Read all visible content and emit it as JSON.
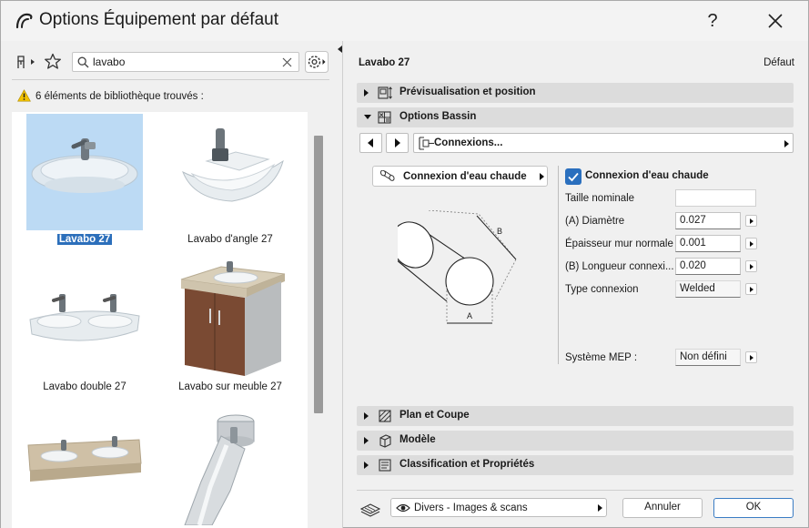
{
  "window": {
    "title": "Options Équipement par défaut",
    "help_label": "?"
  },
  "library": {
    "search": {
      "value": "lavabo",
      "placeholder": ""
    },
    "results_text": "6 éléments de bibliothèque trouvés :",
    "items": [
      {
        "label": "Lavabo 27",
        "selected": true
      },
      {
        "label": "Lavabo d'angle 27",
        "selected": false
      },
      {
        "label": "Lavabo double 27",
        "selected": false
      },
      {
        "label": "Lavabo sur meuble 27",
        "selected": false
      },
      {
        "label": "",
        "selected": false
      },
      {
        "label": "",
        "selected": false
      }
    ]
  },
  "settings": {
    "object_name": "Lavabo 27",
    "default_label": "Défaut",
    "sections": {
      "preview": "Prévisualisation et position",
      "basin_options": "Options Bassin",
      "plan": "Plan et Coupe",
      "model": "Modèle",
      "classification": "Classification et Propriétés"
    },
    "page_select": "Connexions...",
    "connection_button": "Connexion d'eau chaude",
    "diagram_labels": {
      "a": "A",
      "b": "B"
    },
    "params": {
      "enabled_label": "Connexion d'eau chaude",
      "enabled": true,
      "nominal_size": {
        "label": "Taille nominale",
        "value": ""
      },
      "diameter": {
        "label": "(A) Diamètre",
        "value": "0.027"
      },
      "wall_thickness": {
        "label": "Épaisseur mur normale",
        "value": "0.001"
      },
      "length": {
        "label": "(B) Longueur connexi...",
        "value": "0.020"
      },
      "connection_type": {
        "label": "Type connexion",
        "value": "Welded"
      },
      "mep_system": {
        "label": "Système MEP :",
        "value": "Non défini"
      }
    }
  },
  "footer": {
    "layer_value": "Divers - Images & scans",
    "cancel_label": "Annuler",
    "ok_label": "OK"
  },
  "colors": {
    "accent": "#2c6fbb",
    "selection_bg": "#bcdaf4",
    "section_bg": "#dcdcdc",
    "warning": "#f2c200"
  }
}
